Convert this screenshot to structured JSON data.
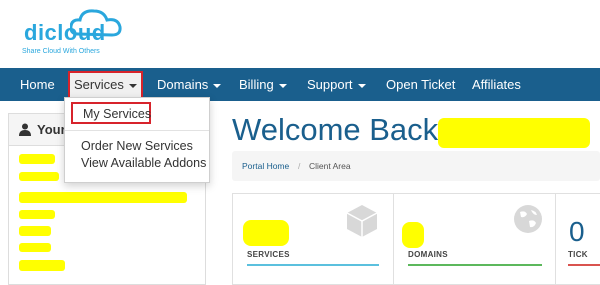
{
  "logo": {
    "wordmark": "dicloud",
    "tagline": "Share Cloud With Others"
  },
  "nav": {
    "items": [
      {
        "label": "Home"
      },
      {
        "label": "Services"
      },
      {
        "label": "Domains"
      },
      {
        "label": "Billing"
      },
      {
        "label": "Support"
      },
      {
        "label": "Open Ticket"
      },
      {
        "label": "Affiliates"
      }
    ]
  },
  "services_menu": {
    "items": [
      {
        "label": "My Services"
      },
      {
        "label": "Order New Services"
      },
      {
        "label": "View Available Addons"
      }
    ]
  },
  "sidebar": {
    "title": "Your"
  },
  "main": {
    "welcome": "Welcome Back,",
    "breadcrumb": {
      "home": "Portal Home",
      "separator": "/",
      "current": "Client Area"
    }
  },
  "tiles": [
    {
      "label": "SERVICES",
      "icon": "cube-icon",
      "accent": "#5bc0de"
    },
    {
      "label": "DOMAINS",
      "icon": "globe-icon",
      "accent": "#5cb85c"
    },
    {
      "label": "TICK",
      "value": "0",
      "accent": "#d9534f"
    }
  ],
  "colors": {
    "navbar": "#1a5f8d",
    "highlight": "#ffff00",
    "annotation": "#d7232b",
    "brand": "#2aa7dd"
  }
}
